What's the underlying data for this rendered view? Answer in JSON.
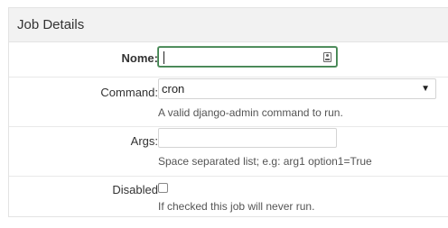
{
  "fieldset": {
    "title": "Job Details"
  },
  "fields": {
    "name": {
      "label": "Nome:",
      "value": "",
      "icon": "contact-card-icon"
    },
    "command": {
      "label": "Command:",
      "selected": "cron",
      "help": "A valid django-admin command to run."
    },
    "args": {
      "label": "Args:",
      "value": "",
      "help": "Space separated list; e.g: arg1 option1=True"
    },
    "disabled": {
      "label": "Disabled",
      "checked": false,
      "help": "If checked this job will never run."
    }
  }
}
